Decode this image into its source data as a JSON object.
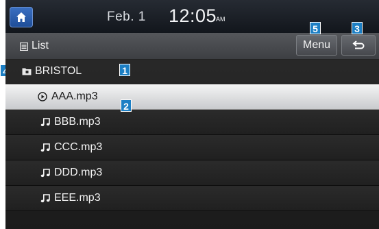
{
  "status_bar": {
    "date": "Feb.  1",
    "time": "12:05",
    "ampm": "AM"
  },
  "title_bar": {
    "title": "List",
    "menu_label": "Menu"
  },
  "folder": {
    "name": "BRISTOL"
  },
  "tracks": [
    {
      "name": "AAA.mp3",
      "state": "playing"
    },
    {
      "name": "BBB.mp3",
      "state": "normal"
    },
    {
      "name": "CCC.mp3",
      "state": "normal"
    },
    {
      "name": "DDD.mp3",
      "state": "normal"
    },
    {
      "name": "EEE.mp3",
      "state": "normal"
    }
  ],
  "callouts": [
    "1",
    "2",
    "3",
    "4",
    "5"
  ],
  "colors": {
    "callout": "#1c7fc4",
    "home_button": "#2a5fb0",
    "selected_row": "#e8e9ea"
  }
}
